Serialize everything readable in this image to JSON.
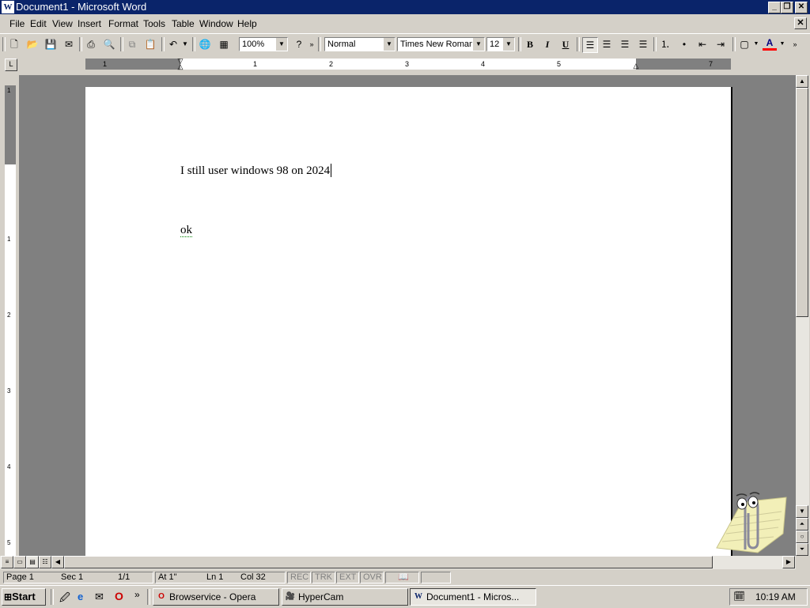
{
  "window": {
    "title": "Document1 - Microsoft Word",
    "app_icon": "W"
  },
  "menus": [
    {
      "label": "File"
    },
    {
      "label": "Edit"
    },
    {
      "label": "View"
    },
    {
      "label": "Insert"
    },
    {
      "label": "Format"
    },
    {
      "label": "Tools"
    },
    {
      "label": "Table"
    },
    {
      "label": "Window"
    },
    {
      "label": "Help"
    }
  ],
  "toolbar": {
    "zoom": "100%",
    "style": "Normal",
    "font": "Times New Roman",
    "size": "12",
    "bold": "B",
    "italic": "I",
    "underline": "U",
    "font_color_glyph": "A"
  },
  "ruler": {
    "numbers": [
      "1",
      "1",
      "2",
      "3",
      "4",
      "5",
      "7"
    ]
  },
  "vruler": {
    "numbers": [
      "1",
      "1",
      "2",
      "3",
      "4",
      "5"
    ]
  },
  "document": {
    "line1": "I still user windows 98 on 2024",
    "line2": "ok"
  },
  "status": {
    "page": "Page 1",
    "sec": "Sec 1",
    "pages": "1/1",
    "at": "At 1\"",
    "ln": "Ln 1",
    "col": "Col 32",
    "rec": "REC",
    "trk": "TRK",
    "ext": "EXT",
    "ovr": "OVR"
  },
  "taskbar": {
    "start": "Start",
    "tasks": [
      {
        "label": "Browservice - Opera"
      },
      {
        "label": "HyperCam"
      },
      {
        "label": "Document1 - Micros..."
      }
    ],
    "clock": "10:19 AM",
    "quick_more": "»"
  },
  "colors": {
    "title_bar": "#0a246a",
    "font_color": "#ff0000",
    "workspace": "#808080"
  }
}
